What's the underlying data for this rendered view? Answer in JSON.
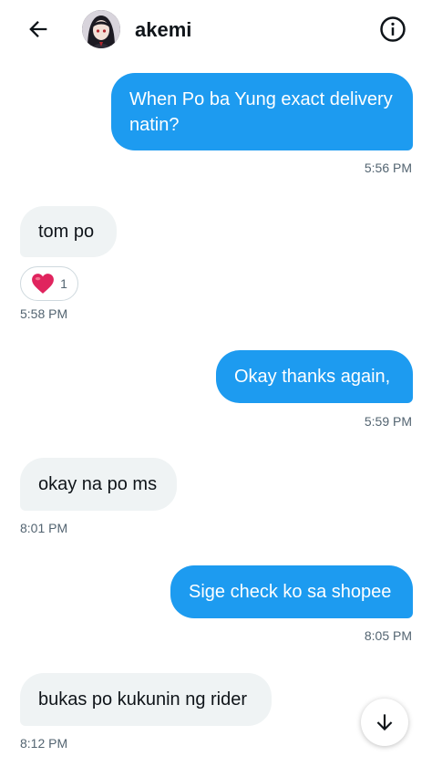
{
  "header": {
    "contact_name": "akemi",
    "back_icon": "arrow-left-icon",
    "info_icon": "info-circle-icon"
  },
  "messages": [
    {
      "direction": "outgoing",
      "text": "When Po ba Yung exact delivery natin?",
      "time": "5:56 PM"
    },
    {
      "direction": "incoming",
      "text": "tom po",
      "time": "5:58 PM",
      "reaction": {
        "emoji": "heart",
        "count": "1"
      }
    },
    {
      "direction": "outgoing",
      "text": "Okay thanks again,",
      "time": "5:59 PM"
    },
    {
      "direction": "incoming",
      "text": "okay na po ms",
      "time": "8:01 PM"
    },
    {
      "direction": "outgoing",
      "text": "Sige check ko sa shopee",
      "time": "8:05 PM"
    },
    {
      "direction": "incoming",
      "text": "bukas po kukunin ng rider",
      "time": "8:12 PM"
    }
  ],
  "scroll_button": {
    "icon": "arrow-down-icon"
  },
  "colors": {
    "outgoing_bubble": "#1d9bf0",
    "incoming_bubble": "#eff3f4",
    "heart": "#e0245e"
  }
}
